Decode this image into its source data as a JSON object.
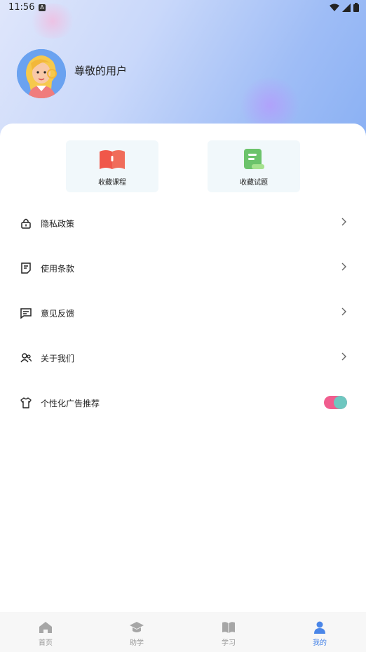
{
  "status_bar": {
    "time": "11:56",
    "notif_glyph": "A"
  },
  "profile": {
    "username": "尊敬的用户"
  },
  "favorites": [
    {
      "label": "收藏课程",
      "icon": "red-book-icon"
    },
    {
      "label": "收藏试题",
      "icon": "green-note-icon"
    }
  ],
  "menu": [
    {
      "label": "隐私政策",
      "icon": "lock-icon"
    },
    {
      "label": "使用条款",
      "icon": "document-icon"
    },
    {
      "label": "意见反馈",
      "icon": "chat-icon"
    },
    {
      "label": "关于我们",
      "icon": "users-icon"
    },
    {
      "label": "个性化广告推荐",
      "icon": "shirt-icon",
      "toggle_on": true
    }
  ],
  "bottom_nav": [
    {
      "label": "首页",
      "icon": "home-icon"
    },
    {
      "label": "助学",
      "icon": "graduation-cap-icon"
    },
    {
      "label": "学习",
      "icon": "open-book-icon"
    },
    {
      "label": "我的",
      "icon": "user-icon",
      "active": true
    }
  ],
  "colors": {
    "accent": "#4a86e8",
    "toggle_track": "#f05d8e",
    "toggle_knob": "#6ec7c0"
  }
}
